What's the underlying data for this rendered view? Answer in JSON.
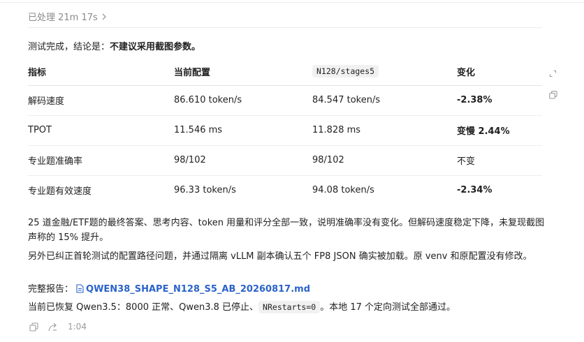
{
  "header": {
    "processed_label": "已处理 21m 17s"
  },
  "conclusion": {
    "prefix": "测试完成，结论是：",
    "bold": "不建议采用截图参数。"
  },
  "table": {
    "headers": [
      "指标",
      "当前配置",
      "N128/stages5",
      "变化"
    ],
    "rows": [
      [
        "解码速度",
        "86.610 token/s",
        "84.547 token/s",
        "-2.38%"
      ],
      [
        "TPOT",
        "11.546 ms",
        "11.828 ms",
        "变慢 2.44%"
      ],
      [
        "专业题准确率",
        "98/102",
        "98/102",
        "不变"
      ],
      [
        "专业题有效速度",
        "96.33 token/s",
        "94.08 token/s",
        "-2.34%"
      ]
    ]
  },
  "paragraphs": {
    "p1": "25 道金融/ETF题的最终答案、思考内容、token 用量和评分全部一致，说明准确率没有变化。但解码速度稳定下降，未复现截图声称的 15% 提升。",
    "p2": "另外已纠正首轮测试的配置路径问题，并通过隔离 vLLM 副本确认五个 FP8 JSON 确实被加载。原 venv 和原配置没有修改。",
    "report_label": "完整报告：",
    "report_file": "QWEN38_SHAPE_N128_S5_AB_20260817.md",
    "p4_prefix": "当前已恢复 Qwen3.5：8000 正常、Qwen3.8 已停止、",
    "p4_code": "NRestarts=0",
    "p4_suffix": "。本地 17 个定向测试全部通过。"
  },
  "footer": {
    "time": "1:04"
  },
  "icons": [
    "chevron-right-icon",
    "expand-icon",
    "copy-icon",
    "file-icon",
    "share-icon"
  ]
}
